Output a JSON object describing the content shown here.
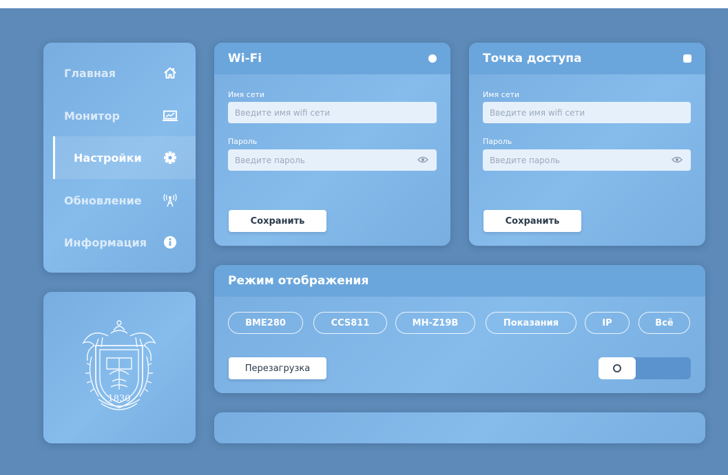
{
  "sidebar": {
    "items": [
      {
        "label": "Главная",
        "icon": "home-icon"
      },
      {
        "label": "Монитор",
        "icon": "monitor-icon"
      },
      {
        "label": "Настройки",
        "icon": "gear-icon",
        "active": true
      },
      {
        "label": "Обновление",
        "icon": "antenna-icon"
      },
      {
        "label": "Информация",
        "icon": "info-icon"
      }
    ]
  },
  "emblem": {
    "year": "1830"
  },
  "wifi": {
    "title": "Wi-Fi",
    "ssid_label": "Имя сети",
    "ssid_placeholder": "Введите имя wifi сети",
    "password_label": "Пароль",
    "password_placeholder": "Введите пароль",
    "save_label": "Сохранить"
  },
  "ap": {
    "title": "Точка доступа",
    "ssid_label": "Имя сети",
    "ssid_placeholder": "Введите имя wifi сети",
    "password_label": "Пароль",
    "password_placeholder": "Введите пароль",
    "save_label": "Сохранить"
  },
  "mode": {
    "title": "Режим отображения",
    "pills": [
      "BME280",
      "CCS811",
      "MH-Z19B",
      "Показания",
      "IP",
      "Всё"
    ],
    "reboot_label": "Перезагрузка",
    "toggle_on": false
  },
  "colors": {
    "background": "#5d8ab8",
    "panel_header": "#6aa6dc",
    "field_bg": "#e6f0fa"
  }
}
